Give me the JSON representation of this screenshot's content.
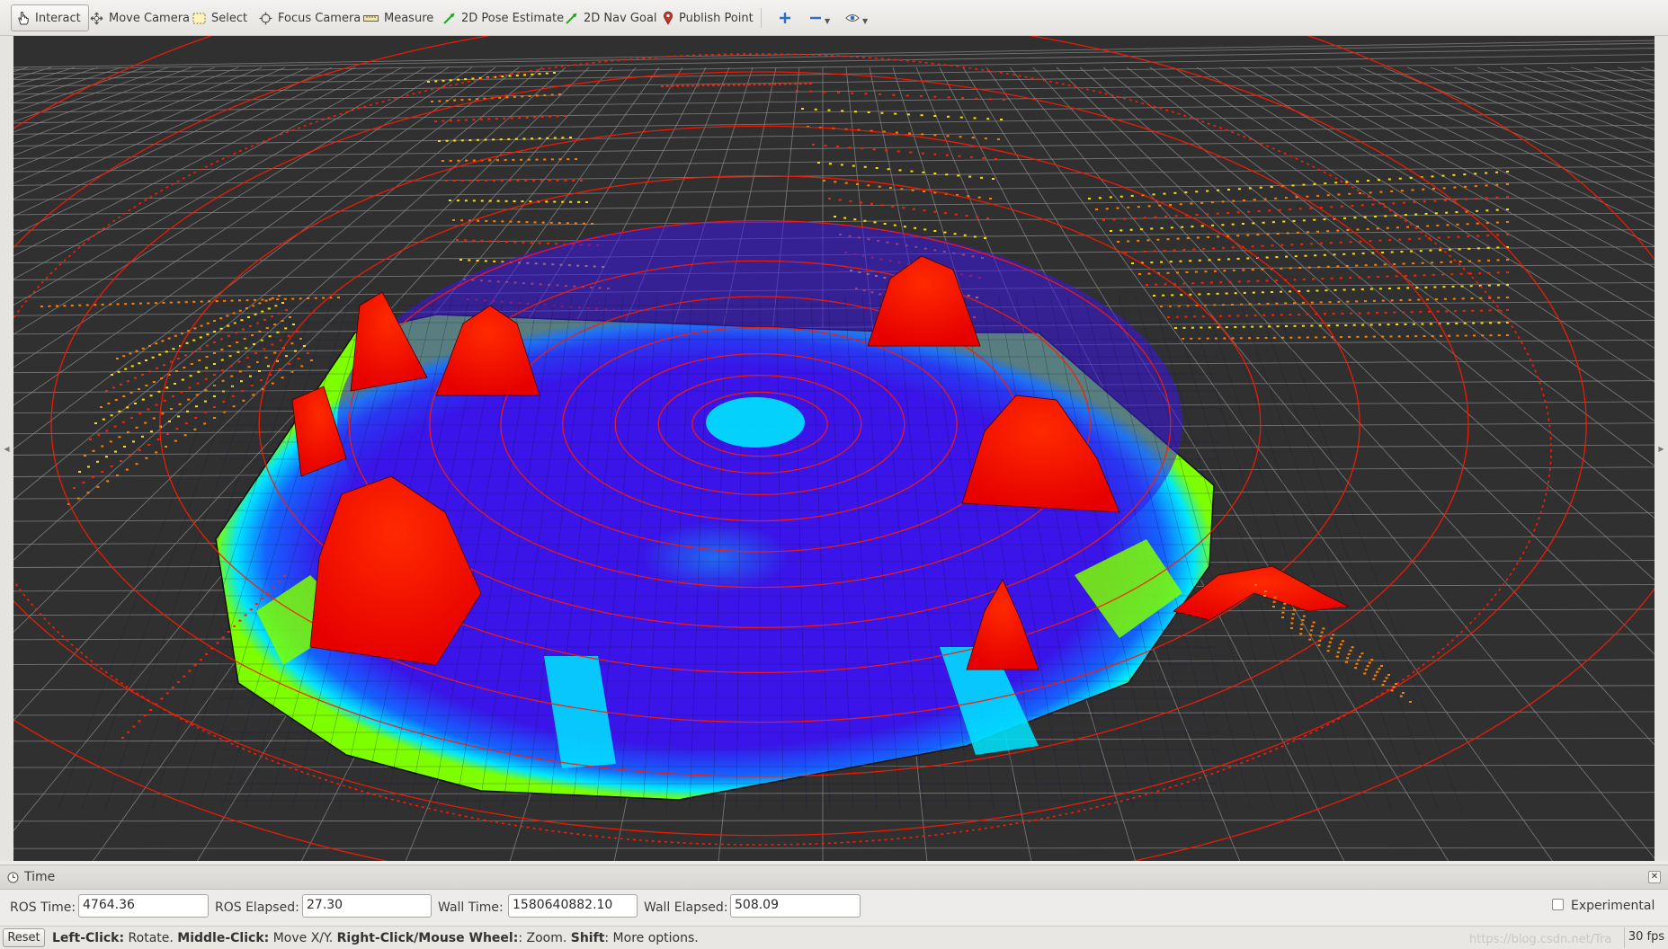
{
  "toolbar": {
    "interact": "Interact",
    "move_camera": "Move Camera",
    "select": "Select",
    "focus_camera": "Focus Camera",
    "measure": "Measure",
    "pose_estimate": "2D Pose Estimate",
    "nav_goal": "2D Nav Goal",
    "publish_point": "Publish Point",
    "add_tool_icon": "plus-icon",
    "remove_tool_icon": "minus-icon",
    "view_icon": "eye-icon"
  },
  "viewport": {
    "background_color": "#303030",
    "grid_color": "#8c8c8c",
    "costmap_colors": [
      "#3a14e8",
      "#1464ff",
      "#00e6ff",
      "#7dff00",
      "#ff1a00"
    ],
    "scan_colors": [
      "#ffe000",
      "#ff8000",
      "#ff2000"
    ]
  },
  "time_panel": {
    "title": "Time",
    "ros_time_label": "ROS Time:",
    "ros_time": "4764.36",
    "ros_elapsed_label": "ROS Elapsed:",
    "ros_elapsed": "27.30",
    "wall_time_label": "Wall Time:",
    "wall_time": "1580640882.10",
    "wall_elapsed_label": "Wall Elapsed:",
    "wall_elapsed": "508.09",
    "experimental_label": "Experimental",
    "experimental_checked": false
  },
  "status": {
    "reset": "Reset",
    "hint_left_click": "Left-Click:",
    "hint_left_action": " Rotate. ",
    "hint_middle_click": "Middle-Click:",
    "hint_middle_action": " Move X/Y. ",
    "hint_right_click": "Right-Click/Mouse Wheel:",
    "hint_right_action": ": Zoom. ",
    "hint_shift": "Shift",
    "hint_shift_action": ": More options.",
    "watermark": "https://blog.csdn.net/Tra",
    "fps": "30 fps"
  }
}
